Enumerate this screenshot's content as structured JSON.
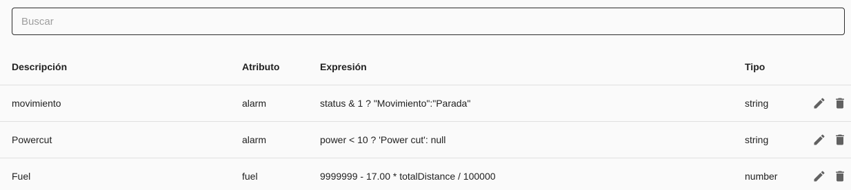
{
  "search": {
    "placeholder": "Buscar",
    "value": ""
  },
  "table": {
    "columns": {
      "description": "Descripción",
      "attribute": "Atributo",
      "expression": "Expresión",
      "type": "Tipo"
    },
    "rows": [
      {
        "description": "movimiento",
        "attribute": "alarm",
        "expression": "status & 1 ? \"Movimiento\":\"Parada\"",
        "type": "string"
      },
      {
        "description": "Powercut",
        "attribute": "alarm",
        "expression": "power < 10 ? 'Power cut': null",
        "type": "string"
      },
      {
        "description": "Fuel",
        "attribute": "fuel",
        "expression": "9999999 - 17.00 * totalDistance / 100000",
        "type": "number"
      }
    ],
    "row_actions": [
      "edit-icon",
      "delete-icon"
    ]
  }
}
